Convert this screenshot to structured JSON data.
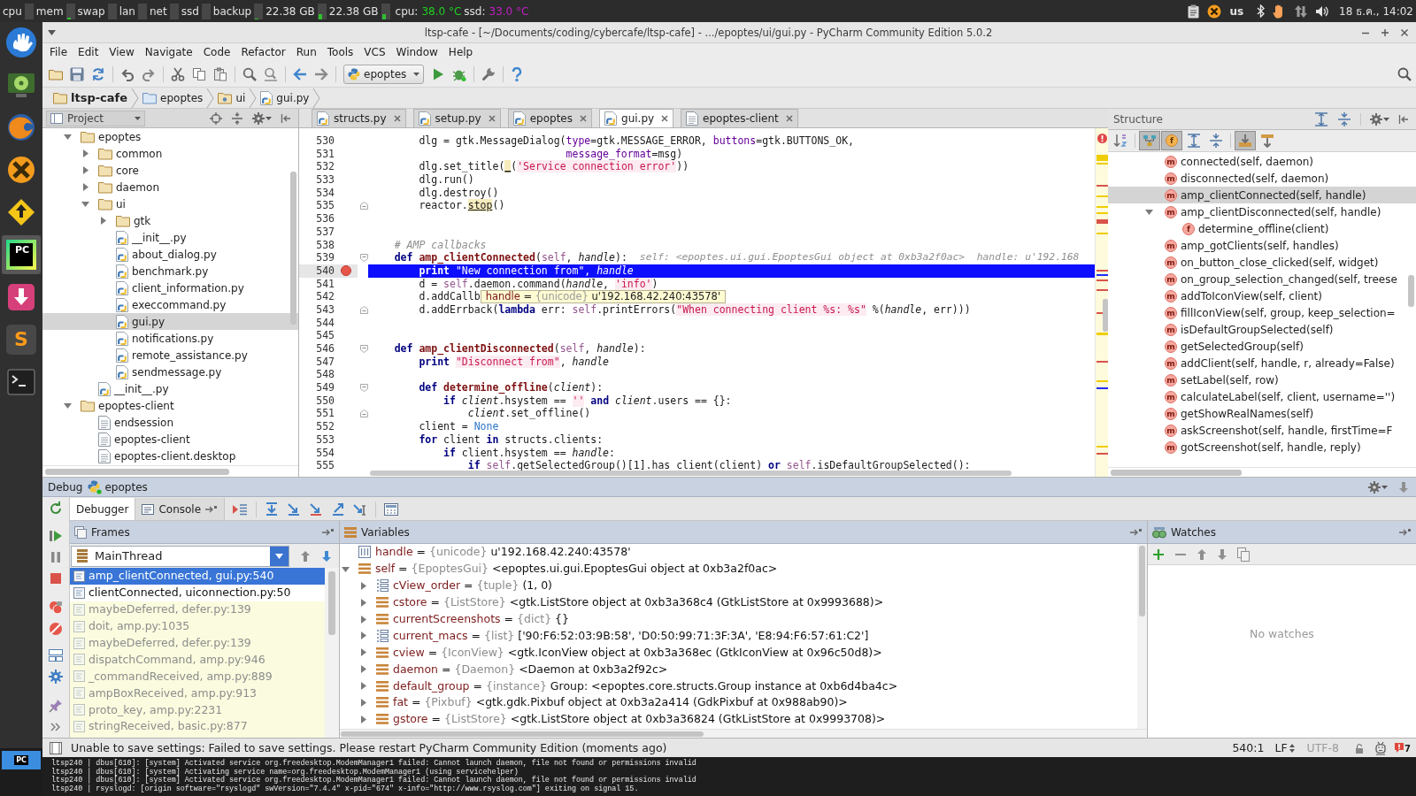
{
  "top_panel": {
    "monitors": [
      "cpu",
      "mem",
      "swap",
      "lan",
      "net",
      "ssd",
      "backup",
      "22.38 GB",
      "22.38 GB"
    ],
    "sensors": [
      {
        "label": "cpu:",
        "value": "38.0 °C",
        "color": "#1fd11f"
      },
      {
        "label": "ssd:",
        "value": "33.0 °C",
        "color": "#c41fc4"
      }
    ],
    "keyboard_layout": "us",
    "clock": "18 ธ.ค., 14:02"
  },
  "dock": {
    "items": [
      {
        "active": false
      },
      {
        "active": false
      },
      {
        "active": false
      },
      {
        "active": false
      },
      {
        "active": false
      },
      {
        "active": true,
        "label": "PC"
      },
      {
        "active": false
      },
      {
        "active": false,
        "label": "S"
      },
      {
        "active": false
      }
    ]
  },
  "taskbar": [
    {
      "label": "PC"
    }
  ],
  "window": {
    "title": "ltsp-cafe - [~/Documents/coding/cybercafe/ltsp-cafe] - .../epoptes/ui/gui.py - PyCharm Community Edition 5.0.2"
  },
  "menu": [
    "File",
    "Edit",
    "View",
    "Navigate",
    "Code",
    "Refactor",
    "Run",
    "Tools",
    "VCS",
    "Window",
    "Help"
  ],
  "toolbar": {
    "run_config": "epoptes"
  },
  "breadcrumbs": [
    {
      "label": "ltsp-cafe",
      "kind": "project"
    },
    {
      "label": "epoptes",
      "kind": "folder"
    },
    {
      "label": "ui",
      "kind": "package"
    },
    {
      "label": "gui.py",
      "kind": "python"
    }
  ],
  "project_panel": {
    "title": "Project",
    "tree": [
      {
        "label": "epoptes",
        "kind": "folder",
        "expanded": true,
        "selected": false,
        "children": [
          {
            "label": "common",
            "kind": "folder",
            "expanded": false,
            "selected": false
          },
          {
            "label": "core",
            "kind": "folder",
            "expanded": false,
            "selected": false
          },
          {
            "label": "daemon",
            "kind": "folder",
            "expanded": false,
            "selected": false
          },
          {
            "label": "ui",
            "kind": "folder",
            "expanded": true,
            "selected": false,
            "children": [
              {
                "label": "gtk",
                "kind": "folder",
                "expanded": false,
                "selected": false
              },
              {
                "label": "__init__.py",
                "kind": "python",
                "selected": false
              },
              {
                "label": "about_dialog.py",
                "kind": "python",
                "selected": false
              },
              {
                "label": "benchmark.py",
                "kind": "python",
                "selected": false
              },
              {
                "label": "client_information.py",
                "kind": "python",
                "selected": false
              },
              {
                "label": "execcommand.py",
                "kind": "python",
                "selected": false
              },
              {
                "label": "gui.py",
                "kind": "python",
                "selected": true
              },
              {
                "label": "notifications.py",
                "kind": "python",
                "selected": false
              },
              {
                "label": "remote_assistance.py",
                "kind": "python",
                "selected": false
              },
              {
                "label": "sendmessage.py",
                "kind": "python",
                "selected": false
              }
            ]
          },
          {
            "label": "__init__.py",
            "kind": "python",
            "selected": false
          }
        ]
      },
      {
        "label": "epoptes-client",
        "kind": "folder",
        "expanded": true,
        "selected": false,
        "children": [
          {
            "label": "endsession",
            "kind": "file",
            "selected": false
          },
          {
            "label": "epoptes-client",
            "kind": "file",
            "selected": false
          },
          {
            "label": "epoptes-client.desktop",
            "kind": "file",
            "selected": false
          }
        ]
      }
    ]
  },
  "editor": {
    "tabs": [
      {
        "label": "structs.py",
        "kind": "python",
        "selected": false
      },
      {
        "label": "setup.py",
        "kind": "python",
        "selected": false
      },
      {
        "label": "epoptes",
        "kind": "python",
        "selected": false
      },
      {
        "label": "gui.py",
        "kind": "python",
        "selected": true
      },
      {
        "label": "epoptes-client",
        "kind": "file",
        "selected": false
      }
    ],
    "lines": [
      {
        "number": "530",
        "kind": "plain",
        "current": false,
        "breakpoint": false,
        "tokens": [
          {
            "kind": "plain",
            "text": "        dlg = gtk.MessageDialog("
          },
          {
            "kind": "kwarg",
            "text": "type"
          },
          {
            "kind": "plain",
            "text": "=gtk.MESSAGE_ERROR, "
          },
          {
            "kind": "kwarg",
            "text": "buttons"
          },
          {
            "kind": "plain",
            "text": "=gtk.BUTTONS_OK,"
          }
        ]
      },
      {
        "number": "531",
        "kind": "plain",
        "current": false,
        "breakpoint": false,
        "tokens": [
          {
            "kind": "kwarg",
            "text": "                                message_format"
          },
          {
            "kind": "plain",
            "text": "=msg)"
          }
        ]
      },
      {
        "number": "532",
        "kind": "plain",
        "current": false,
        "breakpoint": false,
        "tokens": [
          {
            "kind": "plain",
            "text": "        dlg.set_title("
          },
          {
            "kind": "warn",
            "text": "_"
          },
          {
            "kind": "plain",
            "text": "("
          },
          {
            "kind": "str",
            "text": "'Service connection error'"
          },
          {
            "kind": "plain",
            "text": "))"
          }
        ]
      },
      {
        "number": "533",
        "kind": "plain",
        "current": false,
        "breakpoint": false,
        "tokens": [
          {
            "kind": "plain",
            "text": "        dlg.run()"
          }
        ]
      },
      {
        "number": "534",
        "kind": "plain",
        "current": false,
        "breakpoint": false,
        "tokens": [
          {
            "kind": "plain",
            "text": "        dlg.destroy()"
          }
        ]
      },
      {
        "number": "535",
        "kind": "fold_end",
        "current": false,
        "breakpoint": false,
        "tokens": [
          {
            "kind": "plain",
            "text": "        reactor."
          },
          {
            "kind": "warn",
            "text": "stop"
          },
          {
            "kind": "plain",
            "text": "()"
          }
        ]
      },
      {
        "number": "536",
        "kind": "plain",
        "current": false,
        "breakpoint": false
      },
      {
        "number": "537",
        "kind": "plain",
        "current": false,
        "breakpoint": false
      },
      {
        "number": "538",
        "kind": "plain",
        "current": false,
        "breakpoint": false,
        "tokens": [
          {
            "kind": "comment",
            "text": "    # AMP callbacks"
          }
        ]
      },
      {
        "number": "539",
        "kind": "fold_start",
        "current": false,
        "breakpoint": false,
        "tokens": [
          {
            "kind": "kw",
            "text": "    def "
          },
          {
            "kind": "fn",
            "text": "amp_clientConnected"
          },
          {
            "kind": "plain",
            "text": "("
          },
          {
            "kind": "self",
            "text": "self"
          },
          {
            "kind": "plain",
            "text": ", "
          },
          {
            "kind": "param",
            "text": "handle"
          },
          {
            "kind": "plain",
            "text": "):"
          }
        ],
        "hint": "self: <epoptes.ui.gui.EpoptesGui object at 0xb3a2f0ac>  handle: u'192.168"
      },
      {
        "number": "540",
        "kind": "plain",
        "current": true,
        "breakpoint": true,
        "tokens": [
          {
            "kind": "kw",
            "text": "        print "
          },
          {
            "kind": "str",
            "text": "\"New connection from\""
          },
          {
            "kind": "plain",
            "text": ", "
          },
          {
            "kind": "param",
            "text": "handle"
          }
        ]
      },
      {
        "number": "541",
        "kind": "plain",
        "current": false,
        "breakpoint": false,
        "tokens": [
          {
            "kind": "plain",
            "text": "        d = "
          },
          {
            "kind": "self",
            "text": "self"
          },
          {
            "kind": "plain",
            "text": ".daemon.command("
          },
          {
            "kind": "param",
            "text": "handle"
          },
          {
            "kind": "plain",
            "text": ", "
          },
          {
            "kind": "str",
            "text": "'info'"
          },
          {
            "kind": "plain",
            "text": ")"
          }
        ]
      },
      {
        "number": "542",
        "kind": "plain",
        "current": false,
        "breakpoint": false,
        "tokens": [
          {
            "kind": "plain",
            "text": "        d.addCallb"
          }
        ],
        "tooltip": {
          "name": "handle",
          "equals": "=",
          "type": "{unicode}",
          "value": "u'192.168.42.240:43578'"
        }
      },
      {
        "number": "543",
        "kind": "fold_end",
        "current": false,
        "breakpoint": false,
        "tokens": [
          {
            "kind": "plain",
            "text": "        d.addErrback("
          },
          {
            "kind": "kw",
            "text": "lambda"
          },
          {
            "kind": "plain",
            "text": " err: "
          },
          {
            "kind": "self",
            "text": "self"
          },
          {
            "kind": "plain",
            "text": ".printErrors("
          },
          {
            "kind": "str",
            "text": "\"When connecting client %s: %s\""
          },
          {
            "kind": "plain",
            "text": " %("
          },
          {
            "kind": "param",
            "text": "handle"
          },
          {
            "kind": "plain",
            "text": ", err)))"
          }
        ]
      },
      {
        "number": "544",
        "kind": "plain",
        "current": false,
        "breakpoint": false
      },
      {
        "number": "545",
        "kind": "plain",
        "current": false,
        "breakpoint": false
      },
      {
        "number": "546",
        "kind": "fold_start",
        "current": false,
        "breakpoint": false,
        "tokens": [
          {
            "kind": "kw",
            "text": "    def "
          },
          {
            "kind": "fn",
            "text": "amp_clientDisconnected"
          },
          {
            "kind": "plain",
            "text": "("
          },
          {
            "kind": "self",
            "text": "self"
          },
          {
            "kind": "plain",
            "text": ", "
          },
          {
            "kind": "param",
            "text": "handle"
          },
          {
            "kind": "plain",
            "text": "):"
          }
        ]
      },
      {
        "number": "547",
        "kind": "plain",
        "current": false,
        "breakpoint": false,
        "tokens": [
          {
            "kind": "kw",
            "text": "        print "
          },
          {
            "kind": "str",
            "text": "\"Disconnect from\""
          },
          {
            "kind": "plain",
            "text": ", "
          },
          {
            "kind": "param",
            "text": "handle"
          }
        ]
      },
      {
        "number": "548",
        "kind": "plain",
        "current": false,
        "breakpoint": false
      },
      {
        "number": "549",
        "kind": "fold_start",
        "current": false,
        "breakpoint": false,
        "tokens": [
          {
            "kind": "kw",
            "text": "        def "
          },
          {
            "kind": "fn",
            "text": "determine_offline"
          },
          {
            "kind": "plain",
            "text": "("
          },
          {
            "kind": "param",
            "text": "client"
          },
          {
            "kind": "plain",
            "text": "):"
          }
        ]
      },
      {
        "number": "550",
        "kind": "plain",
        "current": false,
        "breakpoint": false,
        "tokens": [
          {
            "kind": "kw",
            "text": "            if "
          },
          {
            "kind": "param",
            "text": "client"
          },
          {
            "kind": "plain",
            "text": ".hsystem == "
          },
          {
            "kind": "str",
            "text": "''"
          },
          {
            "kind": "kw",
            "text": " and "
          },
          {
            "kind": "param",
            "text": "client"
          },
          {
            "kind": "plain",
            "text": ".users == {}:"
          }
        ]
      },
      {
        "number": "551",
        "kind": "fold_end",
        "current": false,
        "breakpoint": false,
        "tokens": [
          {
            "kind": "param",
            "text": "                client"
          },
          {
            "kind": "plain",
            "text": ".set_offline()"
          }
        ]
      },
      {
        "number": "552",
        "kind": "plain",
        "current": false,
        "breakpoint": false,
        "tokens": [
          {
            "kind": "plain",
            "text": "        client = "
          },
          {
            "kind": "const",
            "text": "None"
          }
        ]
      },
      {
        "number": "553",
        "kind": "plain",
        "current": false,
        "breakpoint": false,
        "tokens": [
          {
            "kind": "kw",
            "text": "        for"
          },
          {
            "kind": "plain",
            "text": " client "
          },
          {
            "kind": "kw",
            "text": "in"
          },
          {
            "kind": "plain",
            "text": " structs.clients:"
          }
        ]
      },
      {
        "number": "554",
        "kind": "plain",
        "current": false,
        "breakpoint": false,
        "tokens": [
          {
            "kind": "kw",
            "text": "            if"
          },
          {
            "kind": "plain",
            "text": " client.hsystem == "
          },
          {
            "kind": "param",
            "text": "handle"
          },
          {
            "kind": "plain",
            "text": ":"
          }
        ]
      },
      {
        "number": "555",
        "kind": "plain",
        "current": false,
        "breakpoint": false,
        "tokens": [
          {
            "kind": "kw",
            "text": "                if "
          },
          {
            "kind": "self",
            "text": "self"
          },
          {
            "kind": "plain",
            "text": ".getSelectedGroup()[1].has_client(client) "
          },
          {
            "kind": "kw",
            "text": "or "
          },
          {
            "kind": "self",
            "text": "self"
          },
          {
            "kind": "plain",
            "text": ".isDefaultGroupSelected():"
          }
        ]
      }
    ]
  },
  "structure": {
    "title": "Structure",
    "toggles": [
      {
        "pressed": false
      },
      {
        "pressed": true
      },
      {
        "pressed": true,
        "badge": "f"
      },
      {
        "pressed": false
      },
      {
        "pressed": false
      },
      {
        "pressed": true
      },
      {
        "pressed": false
      }
    ],
    "items": [
      {
        "label": "connected(self, daemon)",
        "badge": "m",
        "selected": false
      },
      {
        "label": "disconnected(self, daemon)",
        "badge": "m",
        "selected": false
      },
      {
        "label": "amp_clientConnected(self, handle)",
        "badge": "m",
        "selected": true
      },
      {
        "label": "amp_clientDisconnected(self, handle)",
        "badge": "m",
        "selected": false,
        "expanded": true,
        "children": [
          {
            "label": "determine_offline(client)",
            "badge": "f",
            "selected": false
          }
        ]
      },
      {
        "label": "amp_gotClients(self, handles)",
        "badge": "m",
        "selected": false
      },
      {
        "label": "on_button_close_clicked(self, widget)",
        "badge": "m",
        "selected": false
      },
      {
        "label": "on_group_selection_changed(self, treese",
        "badge": "m",
        "selected": false
      },
      {
        "label": "addToIconView(self, client)",
        "badge": "m",
        "selected": false
      },
      {
        "label": "fillIconView(self, group, keep_selection=",
        "badge": "m",
        "selected": false
      },
      {
        "label": "isDefaultGroupSelected(self)",
        "badge": "m",
        "selected": false
      },
      {
        "label": "getSelectedGroup(self)",
        "badge": "m",
        "selected": false
      },
      {
        "label": "addClient(self, handle, r, already=False)",
        "badge": "m",
        "selected": false
      },
      {
        "label": "setLabel(self, row)",
        "badge": "m",
        "selected": false
      },
      {
        "label": "calculateLabel(self, client, username='')",
        "badge": "m",
        "selected": false
      },
      {
        "label": "getShowRealNames(self)",
        "badge": "m",
        "selected": false
      },
      {
        "label": "askScreenshot(self, handle, firstTime=F",
        "badge": "m",
        "selected": false
      },
      {
        "label": "gotScreenshot(self, handle, reply)",
        "badge": "m",
        "selected": false
      }
    ]
  },
  "debug": {
    "title": "Debug",
    "config": "epoptes",
    "tabs": [
      {
        "label": "Debugger",
        "selected": true
      },
      {
        "label": "Console",
        "selected": false
      }
    ],
    "frames": {
      "title": "Frames",
      "thread": "MainThread",
      "items": [
        {
          "label": "amp_clientConnected, gui.py:540",
          "selected": true,
          "library": false
        },
        {
          "label": "clientConnected, uiconnection.py:50",
          "selected": false,
          "library": false
        },
        {
          "label": "maybeDeferred, defer.py:139",
          "selected": false,
          "library": true
        },
        {
          "label": "doit, amp.py:1035",
          "selected": false,
          "library": true
        },
        {
          "label": "maybeDeferred, defer.py:139",
          "selected": false,
          "library": true
        },
        {
          "label": "dispatchCommand, amp.py:946",
          "selected": false,
          "library": true
        },
        {
          "label": "_commandReceived, amp.py:889",
          "selected": false,
          "library": true
        },
        {
          "label": "ampBoxReceived, amp.py:913",
          "selected": false,
          "library": true
        },
        {
          "label": "proto_key, amp.py:2231",
          "selected": false,
          "library": true
        },
        {
          "label": "stringReceived, basic.py:877",
          "selected": false,
          "library": true
        }
      ]
    },
    "variables": {
      "title": "Variables",
      "items": [
        {
          "name": "handle",
          "equals": "=",
          "type": "{unicode}",
          "value": "u'192.168.42.240:43578'",
          "kind": "string"
        },
        {
          "name": "self",
          "equals": "=",
          "type": "{EpoptesGui}",
          "value": "<epoptes.ui.gui.EpoptesGui object at 0xb3a2f0ac>",
          "kind": "object",
          "expanded": true,
          "children": [
            {
              "name": "cView_order",
              "equals": "=",
              "type": "{tuple}",
              "value": "(1, 0)",
              "kind": "sequence",
              "expanded": false
            },
            {
              "name": "cstore",
              "equals": "=",
              "type": "{ListStore}",
              "value": "<gtk.ListStore object at 0xb3a368c4 (GtkListStore at 0x9993688)>",
              "kind": "object",
              "expanded": false
            },
            {
              "name": "currentScreenshots",
              "equals": "=",
              "type": "{dict}",
              "value": "{}",
              "kind": "object",
              "expanded": false
            },
            {
              "name": "current_macs",
              "equals": "=",
              "type": "{list}",
              "value": "['90:F6:52:03:9B:58', 'D0:50:99:71:3F:3A', 'E8:94:F6:57:61:C2']",
              "kind": "sequence",
              "expanded": false
            },
            {
              "name": "cview",
              "equals": "=",
              "type": "{IconView}",
              "value": "<gtk.IconView object at 0xb3a368ec (GtkIconView at 0x96c50d8)>",
              "kind": "object",
              "expanded": false
            },
            {
              "name": "daemon",
              "equals": "=",
              "type": "{Daemon}",
              "value": "<Daemon at 0xb3a2f92c>",
              "kind": "object",
              "expanded": false
            },
            {
              "name": "default_group",
              "equals": "=",
              "type": "{instance}",
              "value": "Group: <epoptes.core.structs.Group instance at 0xb6d4ba4c>",
              "kind": "object",
              "expanded": false
            },
            {
              "name": "fat",
              "equals": "=",
              "type": "{Pixbuf}",
              "value": "<gtk.gdk.Pixbuf object at 0xb3a2a414 (GdkPixbuf at 0x988ab90)>",
              "kind": "object",
              "expanded": false
            },
            {
              "name": "gstore",
              "equals": "=",
              "type": "{ListStore}",
              "value": "<gtk.ListStore object at 0xb3a36824 (GtkListStore at 0x9993708)>",
              "kind": "object",
              "expanded": false
            }
          ]
        }
      ]
    },
    "watches": {
      "title": "Watches",
      "empty_text": "No watches"
    }
  },
  "status_bar": {
    "message": "Unable to save settings: Failed to save settings. Please restart PyCharm Community Edition (moments ago)",
    "position": "540:1",
    "line_separator": "LF",
    "encoding": {
      "label": "UTF-8",
      "disabled": true
    },
    "event_count": "7"
  },
  "log": [
    "ltsp240 | dbus[610]: [system] Activated service org.freedesktop.ModemManager1 failed: Cannot launch daemon, file not found or permissions invalid",
    "ltsp240 | dbus[610]: [system] Activating service name=org.freedesktop.ModemManager1 (using servicehelper)",
    "ltsp240 | dbus[610]: [system] Activated service org.freedesktop.ModemManager1 failed: Cannot launch daemon, file not found or permissions invalid",
    "ltsp240 | rsyslogd: [origin software=\"rsyslogd\" swVersion=\"7.4.4\" x-pid=\"674\" x-info=\"http://www.rsyslog.com\"] exiting on signal 15."
  ]
}
